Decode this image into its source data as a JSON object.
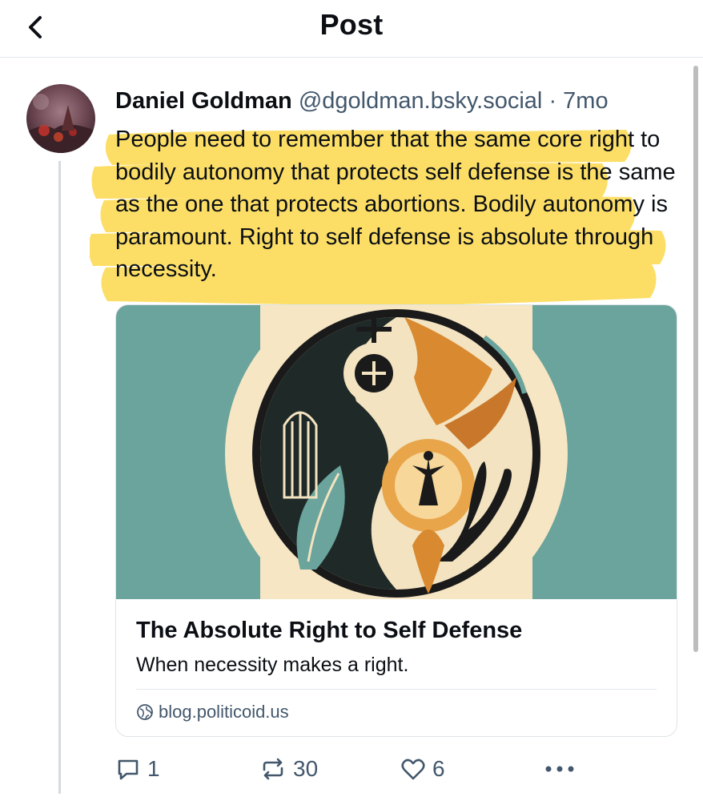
{
  "header": {
    "title": "Post",
    "back_icon": "chevron-left-icon"
  },
  "post": {
    "author_name": "Daniel Goldman",
    "author_handle": "@dgoldman.bsky.social",
    "separator": "·",
    "time": "7mo",
    "text": "People need to remember that the same core right to bodily autonomy that protects self defense is the same as the one that protects abortions. Bodily autonomy is paramount. Right to self defense is absolute through necessity.",
    "highlight_color": "#fcd94c"
  },
  "link_card": {
    "title": "The Absolute Right to Self Defense",
    "description": "When necessity makes a right.",
    "domain": "blog.politicoid.us",
    "domain_icon": "globe-icon"
  },
  "actions": {
    "reply_count": "1",
    "repost_count": "30",
    "like_count": "6"
  },
  "colors": {
    "text_primary": "#0b0f14",
    "text_secondary": "#42576c",
    "image_teal": "#6aa49c",
    "image_cream": "#f6e6c4",
    "image_orange": "#d9892f"
  }
}
